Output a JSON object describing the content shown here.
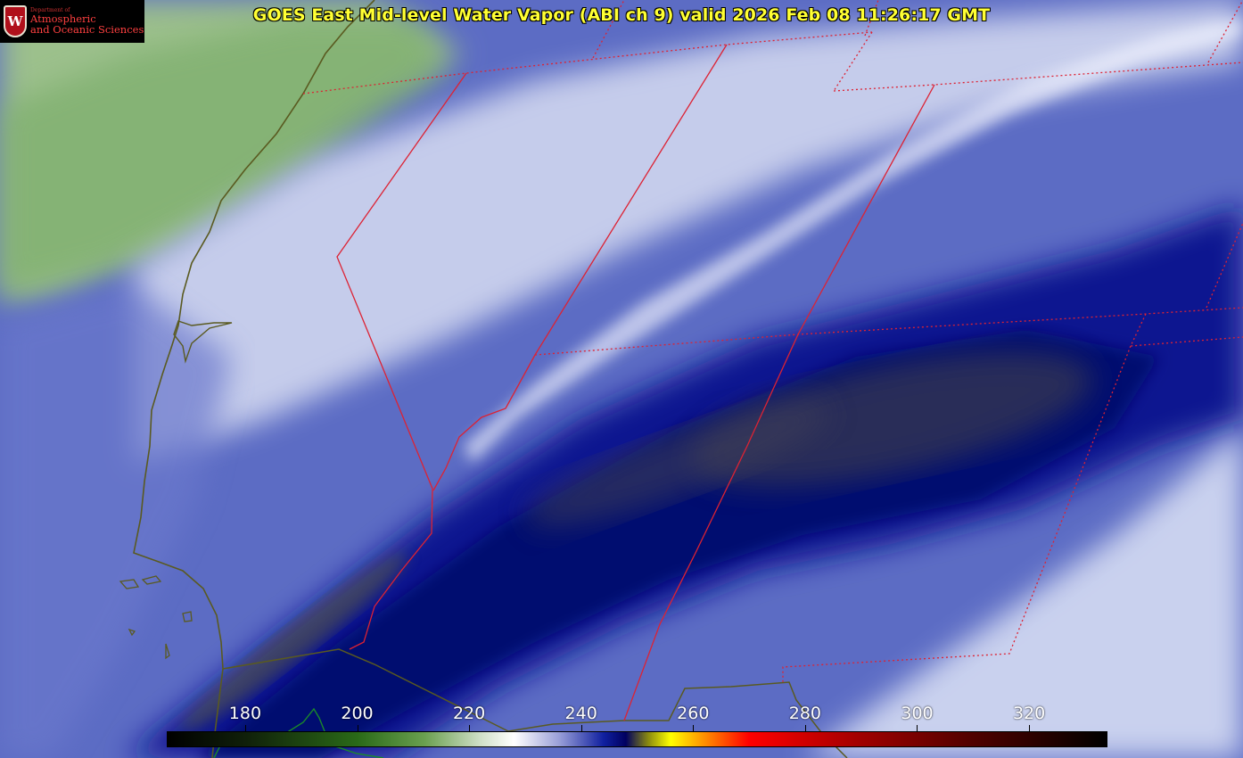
{
  "title": "GOES East Mid-level Water Vapor (ABI ch 9)  valid 2026 Feb 08 11:26:17 GMT",
  "logo": {
    "crest_letter": "W",
    "dept_line": "Department of",
    "line1": "Atmospheric",
    "line2": "and Oceanic Sciences",
    "color": "#b0101b"
  },
  "colorbar": {
    "ticks": [
      {
        "label": "180",
        "value": 180
      },
      {
        "label": "200",
        "value": 200
      },
      {
        "label": "220",
        "value": 220
      },
      {
        "label": "240",
        "value": 240
      },
      {
        "label": "260",
        "value": 260
      },
      {
        "label": "280",
        "value": 280
      },
      {
        "label": "300",
        "value": 300
      },
      {
        "label": "320",
        "value": 320
      }
    ],
    "range": [
      166,
      334
    ],
    "stops": [
      {
        "value": 166,
        "color": "#000000"
      },
      {
        "value": 180,
        "color": "#10200a"
      },
      {
        "value": 200,
        "color": "#2a6a18"
      },
      {
        "value": 212,
        "color": "#6aa050"
      },
      {
        "value": 222,
        "color": "#d0e0c8"
      },
      {
        "value": 228,
        "color": "#ffffff"
      },
      {
        "value": 236,
        "color": "#9aa0d8"
      },
      {
        "value": 244,
        "color": "#1020a0"
      },
      {
        "value": 248,
        "color": "#000060"
      },
      {
        "value": 252,
        "color": "#8a8a10"
      },
      {
        "value": 256,
        "color": "#ffff00"
      },
      {
        "value": 262,
        "color": "#ff9000"
      },
      {
        "value": 270,
        "color": "#ff0000"
      },
      {
        "value": 290,
        "color": "#a00000"
      },
      {
        "value": 310,
        "color": "#500000"
      },
      {
        "value": 334,
        "color": "#000000"
      }
    ]
  },
  "colors": {
    "coastline": "#5a5a20",
    "boundary": "#dd2233",
    "border_green": "#1a8a2a",
    "title": "#ffff33"
  }
}
